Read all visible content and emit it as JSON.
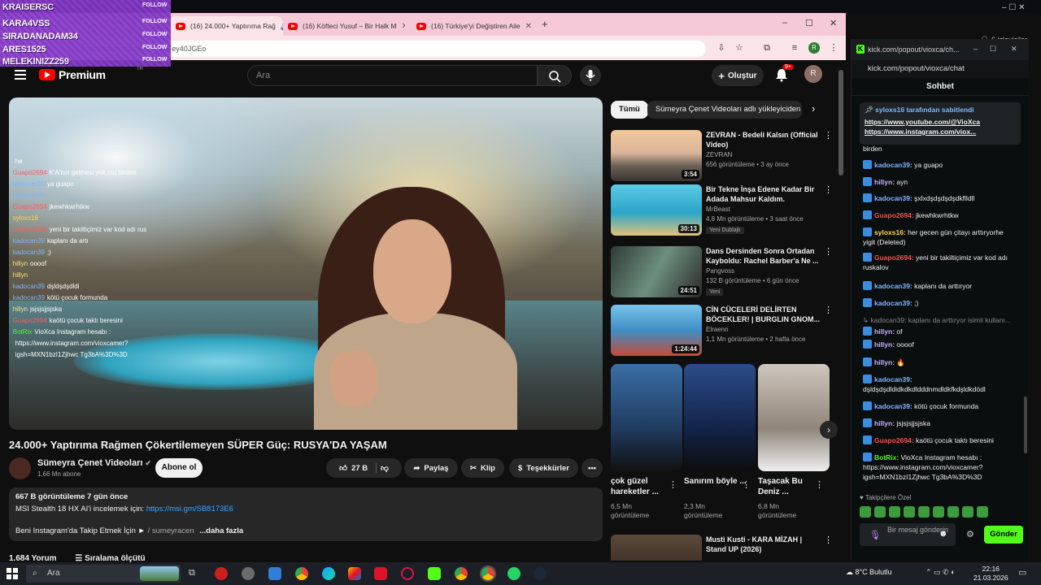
{
  "follower_overlay": {
    "rows": [
      {
        "name": "KRAISERSC",
        "tag": "FOLLOW"
      },
      {
        "name": "KARA4VSS",
        "tag": "FOLLOW"
      },
      {
        "name": "SIRADANADAM34",
        "tag": "FOLLOW"
      },
      {
        "name": "ARES1525",
        "tag": "FOLLOW"
      },
      {
        "name": "MELEKINIZZ259",
        "tag": "FOLLOW"
      }
    ]
  },
  "browser": {
    "tabs": [
      {
        "label": "(16) 24.000+ Yaptırıma Rağ"
      },
      {
        "label": "(16) Köfteci Yusuf – Bir Halk M"
      },
      {
        "label": "(16) Türkiye'yi Değiştiren Aile"
      }
    ],
    "new_tab": "+",
    "url": "youtube.com/watch?v=...AFey40JGEo",
    "window_controls": [
      "–",
      "☐",
      "✕"
    ]
  },
  "youtube": {
    "logo_text": "Premium",
    "logo_region": "TR",
    "search_placeholder": "Ara",
    "create_label": "Oluştur",
    "notif_count": "9+",
    "avatar_letter": "R"
  },
  "video": {
    "title": "24.000+ Yaptırıma Rağmen Çökertilemeyen SÜPER Güç: RUSYA'DA YAŞAM",
    "channel": "Sümeyra Çenet Videoları",
    "subs": "1,66 Mn abone",
    "subscribe": "Abone ol",
    "likes": "27 B",
    "share": "Paylaş",
    "clip": "Klip",
    "thanks": "Teşekkürler",
    "desc_stats": "667 B görüntüleme  7 gün önce",
    "desc_line1": "MSI Stealth 18 HX AI'i incelemek için:",
    "desc_link": "https://msi.gm/SB8173E6",
    "desc_line2": "Beni Instagram'da Takip Etmek İçin ►",
    "desc_ig": "/ sumeyracen",
    "desc_more": "...daha fazla",
    "comments_count": "1.684 Yorum",
    "sort_label": "Sıralama ölçütü"
  },
  "overlay_chat": [
    {
      "user": "",
      "text": "he"
    },
    {
      "user": "Guapo2694",
      "text": "K'A'nın gelmesi yok mu birden"
    },
    {
      "user": "kadocan39",
      "text": "ya guapo"
    },
    {
      "user": "kadocan39",
      "text": ""
    },
    {
      "user": "Guapo2694",
      "text": "jkewhkwrhtkw"
    },
    {
      "user": "syloxs16",
      "text": ""
    },
    {
      "user": "Guapo2694",
      "text": "yeni bir takiltiçimiz var kod adı rus"
    },
    {
      "user": "kadocan39",
      "text": "kaplanı da artı"
    },
    {
      "user": "kadocan39",
      "text": ";)"
    },
    {
      "user": "hillyn",
      "text": "oooof"
    },
    {
      "user": "hillyn",
      "text": ""
    },
    {
      "user": "kadocan39",
      "text": "dşldşdşdldi"
    },
    {
      "user": "kadocan39",
      "text": "kötü çocuk formunda"
    },
    {
      "user": "hillyn",
      "text": "jsjsjsjjsjska"
    },
    {
      "user": "Guapo2694",
      "text": "kaötü çocuk taktı beresini"
    },
    {
      "user": "BotRix",
      "text": "VioXca Instagram hesabı :"
    },
    {
      "user": "",
      "text": "https://www.instagram.com/vioxcamer?"
    },
    {
      "user": "",
      "text": "igsh=MXN1bzI1Zjhwc Tg3bA%3D%3D"
    }
  ],
  "chips": {
    "all": "Tümü",
    "channel": "Sümeyra Çenet Videoları adlı yükleyiciden"
  },
  "recommendations": [
    {
      "title": "ZEVRAN - Bedeli Kalsın (Official Video)",
      "channel": "ZEVRAN",
      "meta": "656 görüntüleme • 3 ay önce",
      "duration": "3:54",
      "badge": ""
    },
    {
      "title": "Bir Tekne İnşa Edene Kadar Bir Adada Mahsur Kaldım.",
      "channel": "MrBeast",
      "meta": "4,8 Mn görüntüleme • 3 saat önce",
      "duration": "30:13",
      "badge": "Yeni   Dublajlı"
    },
    {
      "title": "Dans Dersinden Sonra Ortadan Kayboldu: Rachel Barber'a Ne ...",
      "channel": "Pangvoss",
      "meta": "132 B görüntüleme • 6 gün önce",
      "duration": "24:51",
      "badge": "Yeni"
    },
    {
      "title": "CİN CÜCELERİ DELİRTEN BÖCEKLER! | BURGLIN GNOM...",
      "channel": "Elraenn",
      "meta": "1,1 Mn görüntüleme • 2 hafta önce",
      "duration": "1:24:44",
      "badge": ""
    },
    {
      "title": "Musti Kusti - KARA MİZAH | Stand UP (2026)",
      "channel": "Musti Kusti",
      "meta": "",
      "duration": "",
      "badge": ""
    }
  ],
  "shorts": [
    {
      "title": "çok güzel hareketler ...",
      "views": "6,5 Mn görüntüleme"
    },
    {
      "title": "Sanırım böyle ...",
      "views": "2,3 Mn görüntüleme"
    },
    {
      "title": "Taşacak Bu Deniz ...",
      "views": "6,8 Mn görüntüleme"
    }
  ],
  "kick_chat": {
    "viewers": "6 izleyiciler",
    "url": "kick.com/popout/vioxca/ch...",
    "url_bar": "kick.com/popout/vioxca/chat",
    "header": "Sohbet",
    "pinned_by": "syloxs16 tarafından sabitlendi",
    "pinned_link1": "https://www.youtube.com/@VioXca",
    "pinned_link2": "https://www.instagram.com/viox...",
    "messages": [
      {
        "user": "",
        "text": "birden",
        "color": "#efefef"
      },
      {
        "user": "kadocan39:",
        "text": "ya guapo",
        "color": "#7fb6ff"
      },
      {
        "user": "hillyn:",
        "text": "ayn",
        "color": "#c5b3ff"
      },
      {
        "user": "kadocan39:",
        "text": "şxlxdşdşdşdşdkflldll",
        "color": "#7fb6ff"
      },
      {
        "user": "Guapo2694:",
        "text": "jkewhkwrhtkw",
        "color": "#ff4d4d"
      },
      {
        "user": "syloxs16:",
        "text": "her gecen gün çitayı arttıryorhe yigit (Deleted)",
        "color": "#ffd24d"
      },
      {
        "user": "Guapo2694:",
        "text": "yeni bir takiltiçimiz var kod adı ruskalov",
        "color": "#ff4d4d"
      },
      {
        "user": "kadocan39:",
        "text": "kaplanı da arttıryor",
        "color": "#7fb6ff"
      },
      {
        "user": "kadocan39:",
        "text": ";)",
        "color": "#7fb6ff"
      },
      {
        "user": "",
        "text": "↳ kadocan39: kaplanı da arttıryor isimli kullanı...",
        "color": "#888888"
      },
      {
        "user": "hillyn:",
        "text": "of",
        "color": "#c5b3ff"
      },
      {
        "user": "hillyn:",
        "text": "oooof",
        "color": "#c5b3ff"
      },
      {
        "user": "hillyn:",
        "text": "🔥",
        "color": "#c5b3ff"
      },
      {
        "user": "kadocan39:",
        "text": "dşldşdşdldidkdkdldddnmdldkfkdşldkdödl",
        "color": "#7fb6ff"
      },
      {
        "user": "kadocan39:",
        "text": "kötü çocuk formunda",
        "color": "#7fb6ff"
      },
      {
        "user": "hillyn:",
        "text": "jsjsjsjjsjska",
        "color": "#c5b3ff"
      },
      {
        "user": "Guapo2694:",
        "text": "kaötü çocuk taktı beresini",
        "color": "#ff4d4d"
      },
      {
        "user": "BotRix:",
        "text": "VioXca Instagram hesabı : https://www.instagram.com/vioxcamer?igsh=MXN1bzI1Zjhwc Tg3bA%3D%3D",
        "color": "#53fc18"
      }
    ],
    "followers_only": "Takipçilere Özel",
    "input_placeholder": "Bir mesaj gönderin",
    "send": "Gönder"
  },
  "taskbar": {
    "search": "Ara",
    "weather": "8°C  Bulutlu",
    "time": "22:16",
    "date": "21.03.2026"
  },
  "colors": {
    "kick_green": "#53fc18",
    "yt_red": "#ff0000",
    "link_blue": "#3ea6ff"
  }
}
